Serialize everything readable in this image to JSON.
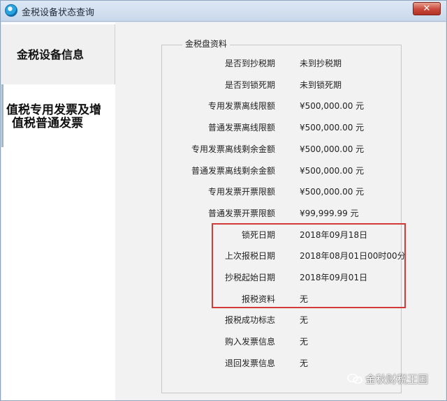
{
  "window": {
    "title": "金税设备状态查询",
    "close_label": "✕"
  },
  "tabs": [
    {
      "label": "金税设备信息"
    },
    {
      "label_line1": "值税专用发票及增",
      "label_line2": "值税普通发票"
    }
  ],
  "group": {
    "title": "金税盘资料",
    "rows": [
      {
        "label": "是否到抄税期",
        "value": "未到抄税期"
      },
      {
        "label": "是否到锁死期",
        "value": "未到锁死期"
      },
      {
        "label": "专用发票离线限额",
        "value": "¥500,000.00 元"
      },
      {
        "label": "普通发票离线限额",
        "value": "¥500,000.00 元"
      },
      {
        "label": "专用发票离线剩余金额",
        "value": "¥500,000.00 元"
      },
      {
        "label": "普通发票离线剩余金额",
        "value": "¥500,000.00 元"
      },
      {
        "label": "专用发票开票限额",
        "value": "¥500,000.00 元"
      },
      {
        "label": "普通发票开票限额",
        "value": "¥99,999.99 元"
      },
      {
        "label": "锁死日期",
        "value": "2018年09月18日"
      },
      {
        "label": "上次报税日期",
        "value": "2018年08月01日00时00分"
      },
      {
        "label": "抄税起始日期",
        "value": "2018年09月01日"
      },
      {
        "label": "报税资料",
        "value": "无"
      },
      {
        "label": "报税成功标志",
        "value": "无"
      },
      {
        "label": "购入发票信息",
        "value": "无"
      },
      {
        "label": "退回发票信息",
        "value": "无"
      }
    ]
  },
  "watermark": {
    "text": "金秋财税王国"
  }
}
